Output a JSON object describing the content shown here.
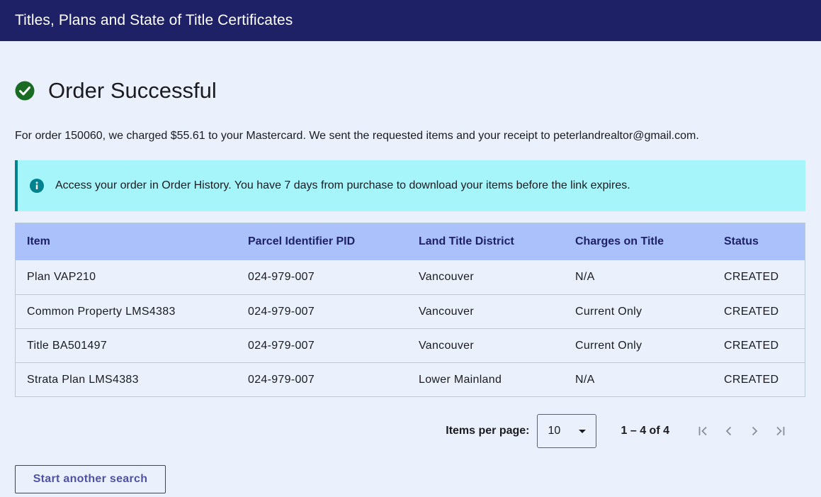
{
  "header": {
    "title": "Titles, Plans and State of Title Certificates"
  },
  "order": {
    "heading": "Order Successful",
    "summary": "For order 150060, we charged $55.61 to your Mastercard. We sent the requested items and your receipt to peterlandrealtor@gmail.com."
  },
  "info_banner": {
    "text": "Access your order in Order History. You have 7 days from purchase to download your items before the link expires."
  },
  "table": {
    "columns": [
      "Item",
      "Parcel Identifier PID",
      "Land Title District",
      "Charges on Title",
      "Status"
    ],
    "rows": [
      [
        "Plan VAP210",
        "024-979-007",
        "Vancouver",
        "N/A",
        "CREATED"
      ],
      [
        "Common Property LMS4383",
        "024-979-007",
        "Vancouver",
        "Current Only",
        "CREATED"
      ],
      [
        "Title BA501497",
        "024-979-007",
        "Vancouver",
        "Current Only",
        "CREATED"
      ],
      [
        "Strata Plan LMS4383",
        "024-979-007",
        "Lower Mainland",
        "N/A",
        "CREATED"
      ]
    ]
  },
  "pagination": {
    "items_per_page_label": "Items per page:",
    "items_per_page_value": "10",
    "range": "1 – 4 of 4"
  },
  "actions": {
    "start_another_search": "Start another search"
  },
  "colors": {
    "header_bg": "#1f2167",
    "banner_bg": "#a6f5fb",
    "table_header_bg": "#aac1fb",
    "success_green": "#1a6b23"
  }
}
